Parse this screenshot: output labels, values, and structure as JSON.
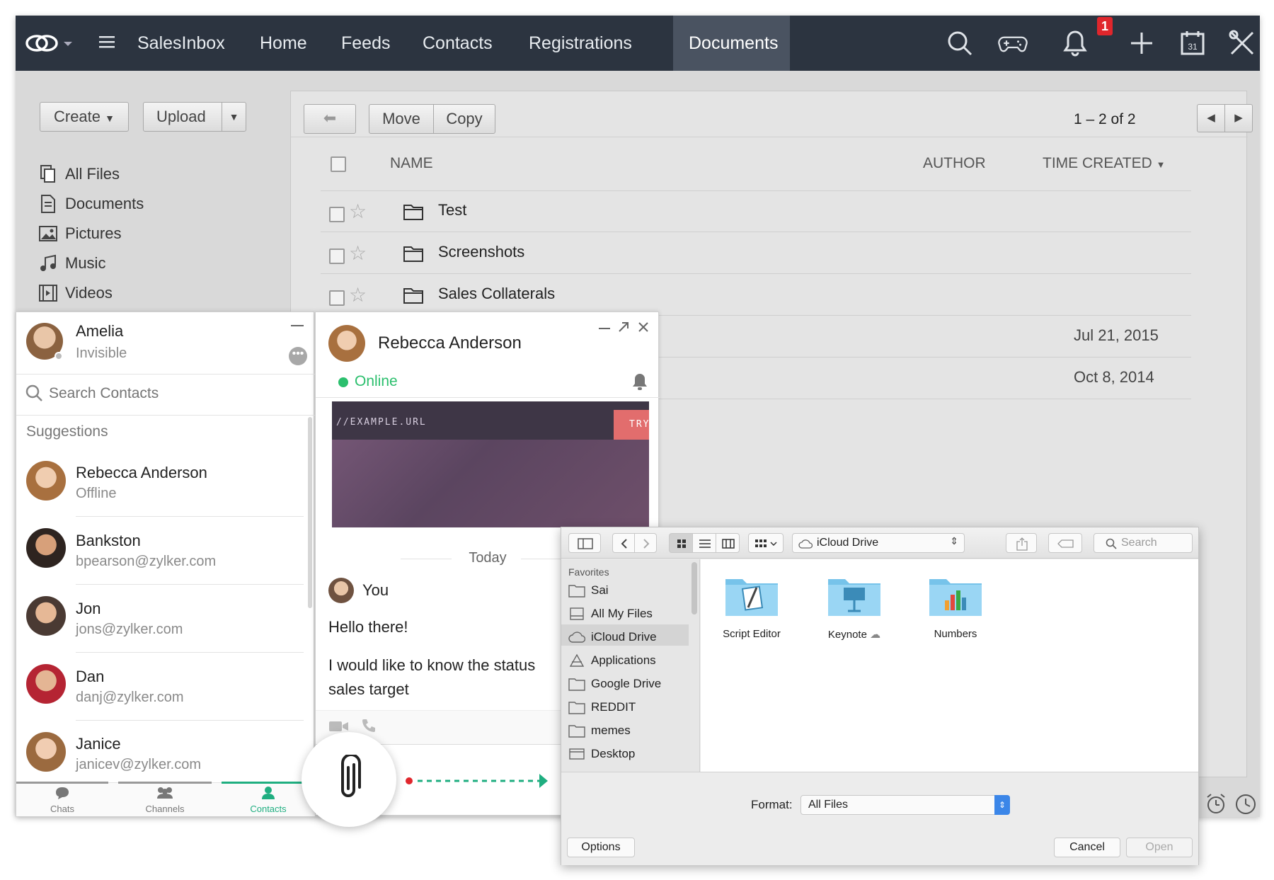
{
  "topbar": {
    "nav": [
      "SalesInbox",
      "Home",
      "Feeds",
      "Contacts",
      "Registrations",
      "Documents"
    ],
    "active_nav": "Documents",
    "notification_count": "1",
    "calendar_day": "31"
  },
  "sidebar": {
    "create_label": "Create",
    "upload_label": "Upload",
    "items": [
      "All Files",
      "Documents",
      "Pictures",
      "Music",
      "Videos"
    ]
  },
  "files": {
    "move_label": "Move",
    "copy_label": "Copy",
    "pagination": "1 – 2 of 2",
    "columns": {
      "name": "NAME",
      "author": "AUTHOR",
      "time_created": "TIME CREATED"
    },
    "rows": [
      {
        "name": "Test",
        "date": ""
      },
      {
        "name": "Screenshots",
        "date": ""
      },
      {
        "name": "Sales Collaterals",
        "date": ""
      },
      {
        "name": "",
        "date": "Jul 21, 2015"
      },
      {
        "name": "",
        "date": "Oct 8, 2014"
      }
    ]
  },
  "contacts": {
    "me": {
      "name": "Amelia",
      "status": "Invisible"
    },
    "search_placeholder": "Search Contacts",
    "section": "Suggestions",
    "list": [
      {
        "name": "Rebecca Anderson",
        "sub": "Offline"
      },
      {
        "name": "Bankston",
        "sub": "bpearson@zylker.com"
      },
      {
        "name": "Jon",
        "sub": "jons@zylker.com"
      },
      {
        "name": "Dan",
        "sub": "danj@zylker.com"
      },
      {
        "name": "Janice",
        "sub": "janicev@zylker.com"
      }
    ],
    "tabs": [
      "Chats",
      "Channels",
      "Contacts"
    ],
    "active_tab": "Contacts"
  },
  "chat": {
    "name": "Rebecca Anderson",
    "status": "Online",
    "preview_url": "//EXAMPLE.URL",
    "preview_btn": "TRY",
    "day": "Today",
    "sender": "You",
    "messages": [
      "Hello there!",
      "I would like to know the status",
      "sales target"
    ]
  },
  "finder": {
    "location": "iCloud Drive",
    "search_placeholder": "Search",
    "favorites_label": "Favorites",
    "favorites": [
      "Sai",
      "All My Files",
      "iCloud Drive",
      "Applications",
      "Google Drive",
      "REDDIT",
      "memes",
      "Desktop"
    ],
    "selected_favorite": "iCloud Drive",
    "items": [
      "Script Editor",
      "Keynote",
      "Numbers"
    ],
    "format_label": "Format:",
    "format_value": "All Files",
    "options_label": "Options",
    "cancel_label": "Cancel",
    "open_label": "Open"
  },
  "colors": {
    "topbar": "#2c3440",
    "online": "#2bbf6d",
    "accent": "#1fae80",
    "badge": "#e0262c"
  }
}
